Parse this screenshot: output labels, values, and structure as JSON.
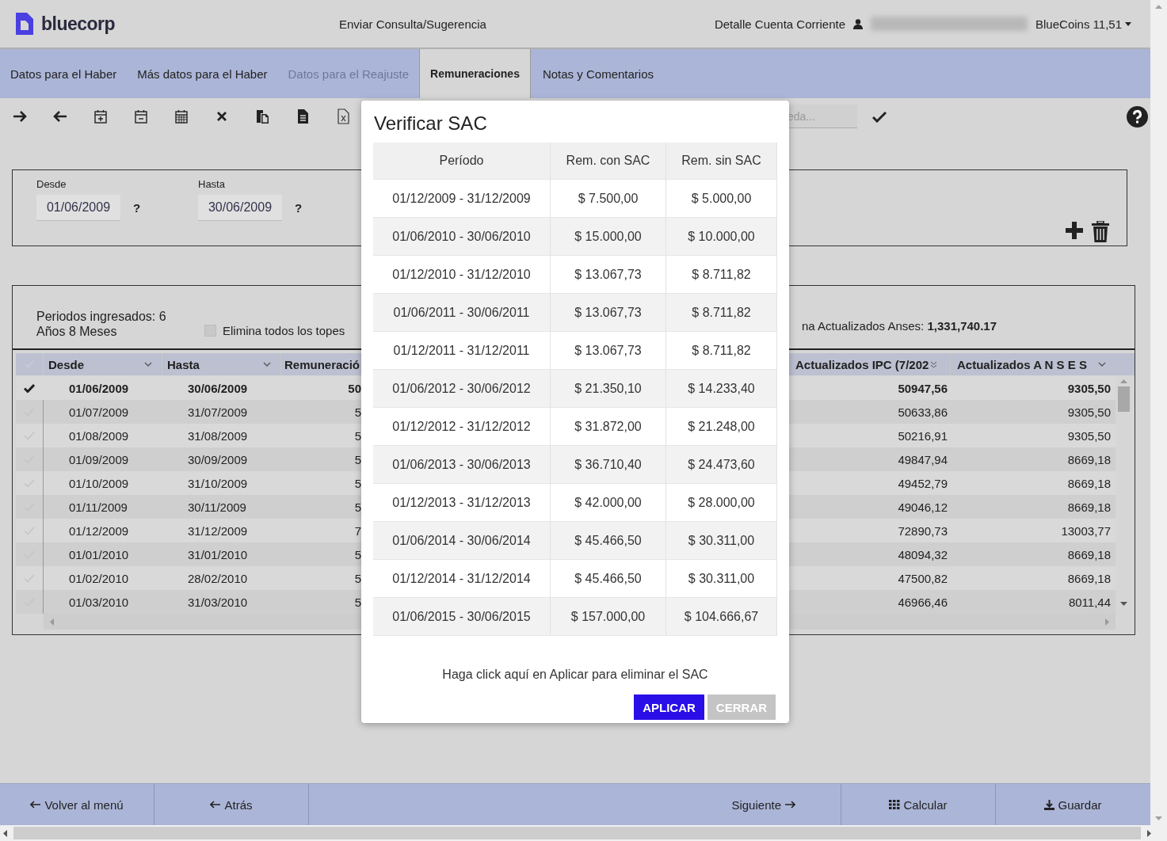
{
  "header": {
    "brand": "bluecorp",
    "links": [
      "Enviar Consulta/Sugerencia",
      "Detalle Cuenta Corriente"
    ],
    "balance": "BlueCoins 11,51"
  },
  "tabs": [
    {
      "label": "Datos para el Haber",
      "selected": false,
      "disabled": false
    },
    {
      "label": "Más datos para el Haber",
      "selected": false,
      "disabled": false
    },
    {
      "label": "Datos para el Reajuste",
      "selected": false,
      "disabled": true
    },
    {
      "label": "Remuneraciones",
      "selected": true,
      "disabled": false
    },
    {
      "label": "Notas y Comentarios",
      "selected": false,
      "disabled": false
    }
  ],
  "toolbar": {
    "search": {
      "placeholder": "eda..."
    }
  },
  "filter": {
    "fields": [
      {
        "label": "Desde",
        "value": "01/06/2009",
        "help": "?"
      },
      {
        "label": "Hasta",
        "value": "30/06/2009",
        "help": "?"
      }
    ]
  },
  "summary": {
    "periods": "Periodos ingresados: 6 Años 8 Meses",
    "remove_caps": {
      "label": "Elimina todos los topes",
      "checked": false
    },
    "total": "na Actualizados Anses: **1,331,740.17**"
  },
  "grid": {
    "columns": [
      "Desde",
      "Hasta",
      "Remuneració",
      "Actualizados IPC (7/202",
      "Actualizados A N S E S"
    ],
    "rows": [
      {
        "selected": true,
        "cells": [
          "01/06/2009",
          "30/06/2009",
          "50",
          "50947,56",
          "9305,50"
        ]
      },
      {
        "selected": false,
        "cells": [
          "01/07/2009",
          "31/07/2009",
          "5",
          "50633,86",
          "9305,50"
        ]
      },
      {
        "selected": false,
        "cells": [
          "01/08/2009",
          "31/08/2009",
          "5",
          "50216,91",
          "9305,50"
        ]
      },
      {
        "selected": false,
        "cells": [
          "01/09/2009",
          "30/09/2009",
          "5",
          "49847,94",
          "8669,18"
        ]
      },
      {
        "selected": false,
        "cells": [
          "01/10/2009",
          "31/10/2009",
          "5",
          "49452,79",
          "8669,18"
        ]
      },
      {
        "selected": false,
        "cells": [
          "01/11/2009",
          "30/11/2009",
          "5",
          "49046,12",
          "8669,18"
        ]
      },
      {
        "selected": false,
        "cells": [
          "01/12/2009",
          "31/12/2009",
          "7",
          "72890,73",
          "13003,77"
        ]
      },
      {
        "selected": false,
        "cells": [
          "01/01/2010",
          "31/01/2010",
          "5",
          "48094,32",
          "8669,18"
        ]
      },
      {
        "selected": false,
        "cells": [
          "01/02/2010",
          "28/02/2010",
          "5",
          "47500,82",
          "8669,18"
        ]
      },
      {
        "selected": false,
        "cells": [
          "01/03/2010",
          "31/03/2010",
          "5",
          "46966,46",
          "8011,44"
        ]
      }
    ]
  },
  "dialog": {
    "title": "Verificar SAC",
    "columns": [
      "Período",
      "Rem. con SAC",
      "Rem. sin SAC"
    ],
    "rows": [
      [
        "01/12/2009 - 31/12/2009",
        "$ 7.500,00",
        "$ 5.000,00"
      ],
      [
        "01/06/2010 - 30/06/2010",
        "$ 15.000,00",
        "$ 10.000,00"
      ],
      [
        "01/12/2010 - 31/12/2010",
        "$ 13.067,73",
        "$ 8.711,82"
      ],
      [
        "01/06/2011 - 30/06/2011",
        "$ 13.067,73",
        "$ 8.711,82"
      ],
      [
        "01/12/2011 - 31/12/2011",
        "$ 13.067,73",
        "$ 8.711,82"
      ],
      [
        "01/06/2012 - 30/06/2012",
        "$ 21.350,10",
        "$ 14.233,40"
      ],
      [
        "01/12/2012 - 31/12/2012",
        "$ 31.872,00",
        "$ 21.248,00"
      ],
      [
        "01/06/2013 - 30/06/2013",
        "$ 36.710,40",
        "$ 24.473,60"
      ],
      [
        "01/12/2013 - 31/12/2013",
        "$ 42.000,00",
        "$ 28.000,00"
      ],
      [
        "01/06/2014 - 30/06/2014",
        "$ 45.466,50",
        "$ 30.311,00"
      ],
      [
        "01/12/2014 - 31/12/2014",
        "$ 45.466,50",
        "$ 30.311,00"
      ],
      [
        "01/06/2015 - 30/06/2015",
        "$ 157.000,00",
        "$ 104.666,67"
      ]
    ],
    "note": "Haga click aquí en Aplicar para eliminar el SAC",
    "buttons": [
      {
        "label": "APLICAR",
        "disabled": false
      },
      {
        "label": "CERRAR",
        "disabled": true
      }
    ]
  },
  "footer": [
    {
      "label": "Volver al menú",
      "kind": "back"
    },
    {
      "label": "Atrás",
      "kind": "back"
    },
    {
      "label": "Siguiente",
      "kind": "next"
    },
    {
      "label": "Calcular",
      "kind": "calculate"
    },
    {
      "label": "Guardar",
      "kind": "save"
    }
  ]
}
